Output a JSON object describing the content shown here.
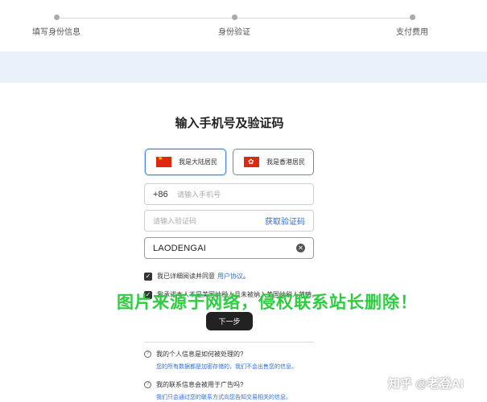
{
  "steps": [
    "填写身份信息",
    "身份验证",
    "支付费用"
  ],
  "title": "输入手机号及验证码",
  "regions": [
    {
      "label": "我是大陆居民",
      "flag": "cn-flag"
    },
    {
      "label": "我是香港居民",
      "flag": "hk-flag"
    }
  ],
  "phone": {
    "prefix": "+86",
    "placeholder": "请输入手机号"
  },
  "code": {
    "placeholder": "请输入验证码",
    "get_code": "获取验证码"
  },
  "name_field": {
    "value": "LAODENGAI",
    "clear_icon": "clear-icon"
  },
  "agreements": {
    "read_text": "我已详细阅读并同意",
    "read_link": "用户协议",
    "read_suffix": "。",
    "tax_text": "我承诺本人不是美国纳税人且未被纳入美国纳税人范畴。"
  },
  "watermark": "图片来源于网络，侵权联系站长删除！",
  "next_button": "下一步",
  "faq": [
    {
      "q": "我的个人信息是如何被处理的?",
      "a": "您的所有数据都是加密存储的，我们不会出售您的信息。"
    },
    {
      "q": "我的联系信息会被用于广告吗?",
      "a": "我们只会通过您的联系方式向您告知交易相关的信息。"
    }
  ],
  "branding": "知乎 @老登AI",
  "colors": {
    "accent": "#2f6fd6",
    "primary_button": "#222222",
    "band": "#e9f1fa",
    "watermark": "#2ecc40"
  }
}
